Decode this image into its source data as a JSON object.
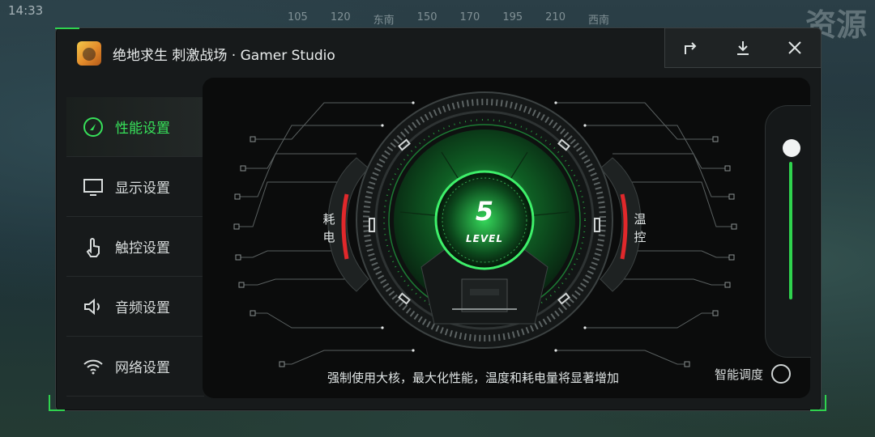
{
  "background": {
    "time": "14:33",
    "compass": [
      "105",
      "120",
      "东南",
      "150",
      "170",
      "195",
      "210",
      "西南"
    ],
    "corner_word": "资源"
  },
  "app": {
    "title": "绝地求生 刺激战场 · Gamer Studio",
    "icon": "game-app-icon"
  },
  "window_controls": [
    {
      "name": "share-button",
      "icon": "share-arrow-icon",
      "glyph": "↱"
    },
    {
      "name": "download-button",
      "icon": "download-icon",
      "glyph": "⤓"
    },
    {
      "name": "close-button",
      "icon": "close-icon",
      "glyph": "✕"
    }
  ],
  "sidebar": {
    "items": [
      {
        "label": "性能设置",
        "icon": "performance-gauge-icon",
        "active": true
      },
      {
        "label": "显示设置",
        "icon": "monitor-icon",
        "active": false
      },
      {
        "label": "触控设置",
        "icon": "touch-hand-icon",
        "active": false
      },
      {
        "label": "音频设置",
        "icon": "speaker-icon",
        "active": false
      },
      {
        "label": "网络设置",
        "icon": "wifi-icon",
        "active": false
      }
    ]
  },
  "performance": {
    "level_number": "5",
    "level_label": "LEVEL",
    "left_label": "耗电",
    "right_label": "温控",
    "description": "强制使用大核，最大化性能，温度和耗电量将显著增加",
    "smart_label": "智能调度",
    "smart_enabled": false,
    "slider_value": 5,
    "slider_max": 5
  },
  "colors": {
    "accent": "#2fd34e",
    "panel": "#171a1b",
    "danger": "#e0282b"
  }
}
